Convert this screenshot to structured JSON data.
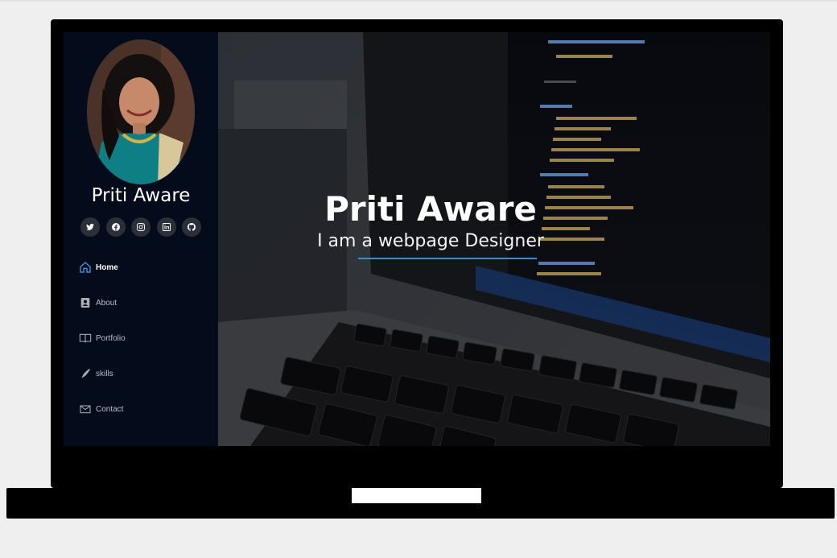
{
  "profile": {
    "name": "Priti Aware"
  },
  "socials": [
    {
      "icon": "twitter-icon"
    },
    {
      "icon": "facebook-icon"
    },
    {
      "icon": "instagram-icon"
    },
    {
      "icon": "linkedin-icon"
    },
    {
      "icon": "github-icon"
    }
  ],
  "nav": {
    "items": [
      {
        "label": "Home",
        "icon": "home-icon",
        "active": true
      },
      {
        "label": "About",
        "icon": "person-card-icon",
        "active": false
      },
      {
        "label": "Portfolio",
        "icon": "book-icon",
        "active": false
      },
      {
        "label": "skills",
        "icon": "pen-icon",
        "active": false
      },
      {
        "label": "Contact",
        "icon": "envelope-icon",
        "active": false
      }
    ]
  },
  "hero": {
    "name": "Priti Aware",
    "subtitle": "I am a webpage Designer"
  },
  "colors": {
    "sidebar_bg": "#040b1a",
    "accent": "#3d8ad8",
    "home_icon": "#3ea6ff"
  }
}
